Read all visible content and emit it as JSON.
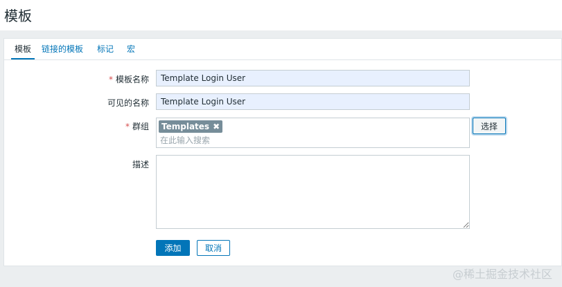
{
  "page": {
    "title": "模板"
  },
  "tabs": [
    {
      "label": "模板",
      "active": true
    },
    {
      "label": "链接的模板",
      "active": false
    },
    {
      "label": "标记",
      "active": false
    },
    {
      "label": "宏",
      "active": false
    }
  ],
  "form": {
    "template_name": {
      "label": "模板名称",
      "required": true,
      "value": "Template Login User"
    },
    "visible_name": {
      "label": "可见的名称",
      "required": false,
      "value": "Template Login User"
    },
    "groups": {
      "label": "群组",
      "required": true,
      "tags": [
        "Templates"
      ],
      "search_placeholder": "在此输入搜索",
      "select_button": "选择"
    },
    "description": {
      "label": "描述",
      "value": ""
    }
  },
  "actions": {
    "add_label": "添加",
    "cancel_label": "取消"
  },
  "watermark": "@稀土掘金技术社区",
  "colors": {
    "accent": "#0275b8",
    "required": "#d64e4e",
    "tag_bg": "#768d99"
  }
}
